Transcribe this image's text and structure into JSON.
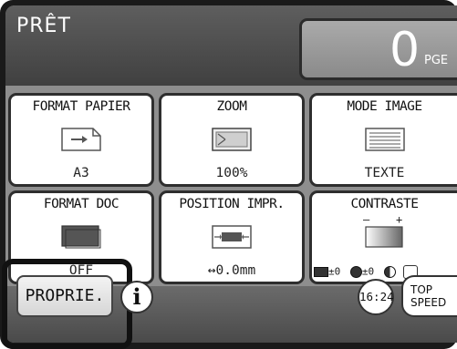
{
  "status": {
    "text": "PRÊT"
  },
  "counter": {
    "value": "0",
    "unit": "PGE"
  },
  "tiles": [
    {
      "label": "FORMAT PAPIER",
      "value": "A3",
      "icon": "paper-size-icon"
    },
    {
      "label": "ZOOM",
      "value": "100%",
      "icon": "zoom-icon"
    },
    {
      "label": "MODE IMAGE",
      "value": "TEXTE",
      "icon": "text-mode-icon"
    },
    {
      "label": "FORMAT DOC",
      "value": "OFF",
      "icon": "document-format-icon"
    },
    {
      "label": "POSITION IMPR.",
      "value": "↔0.0mm",
      "icon": "print-position-icon"
    },
    {
      "label": "CONTRASTE",
      "value": "",
      "icon": "contrast-scale-icon",
      "scale": {
        "minus": "–",
        "plus": "+"
      },
      "readouts": [
        "±0",
        "±0"
      ]
    }
  ],
  "bottom": {
    "custom_label": "PROPRIE.",
    "info_label": "i",
    "clock_label": "16:24",
    "speed_label_1": "TOP",
    "speed_label_2": "SPEED"
  },
  "colors": {
    "status_bar": "#4a4a4a",
    "tile_bg": "#ffffff",
    "grid_bg": "#8e8e8e"
  }
}
